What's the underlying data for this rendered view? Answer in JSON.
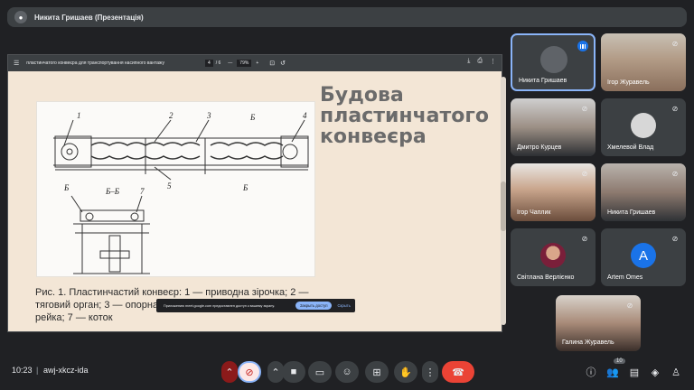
{
  "presenter": {
    "name": "Никита Гришаев (Презентація)"
  },
  "pdf_viewer": {
    "title": "пластинчатого конвеєра для транспортування насипного вантажу",
    "page_current": "4",
    "page_total": "/ 6",
    "zoom": "79%"
  },
  "slide": {
    "title_lines": [
      "Будова",
      "пластинчатого",
      "конвеєра"
    ],
    "caption": "Рис. 1. Пластинчастий конвеєр: 1 — приводна зірочка; 2 — тяговий орган; 3 — опорна зірочка; 5 — ходова частина; 6 — рейка; 7 — коток",
    "drawing_labels": [
      "1",
      "2",
      "3",
      "Б",
      "4",
      "5",
      "Б",
      "Б",
      "Б–Б",
      "7"
    ]
  },
  "notice": {
    "text": "Приложению meet.google.com предоставлен доступ к вашему экрану.",
    "button": "Закрыть доступ",
    "close": "Скрыть"
  },
  "participants": [
    {
      "name": "Никита Гришаев",
      "avatar_initial": "",
      "active": true,
      "muted": false,
      "type": "avatar"
    },
    {
      "name": "Ігор Журавель",
      "muted": true,
      "type": "video"
    },
    {
      "name": "Дмитро Курцев",
      "muted": true,
      "type": "video"
    },
    {
      "name": "Хмелевой Влад",
      "muted": true,
      "type": "avatar"
    },
    {
      "name": "Ігор Чаплик",
      "muted": true,
      "type": "video"
    },
    {
      "name": "Никита Гришаев",
      "muted": true,
      "type": "video"
    },
    {
      "name": "Світлана Верлієнко",
      "muted": true,
      "type": "avatar"
    },
    {
      "name": "Artem Omes",
      "avatar_initial": "A",
      "muted": true,
      "type": "avatar"
    },
    {
      "name": "Галина Журавель",
      "muted": true,
      "type": "video"
    }
  ],
  "bottom_bar": {
    "time": "10:23",
    "separator": "|",
    "meeting_code": "awj-xkcz-ida",
    "people_count": "10"
  },
  "colors": {
    "accent": "#8ab4f8",
    "hangup": "#ea4335",
    "artem_avatar": "#1a73e8"
  }
}
